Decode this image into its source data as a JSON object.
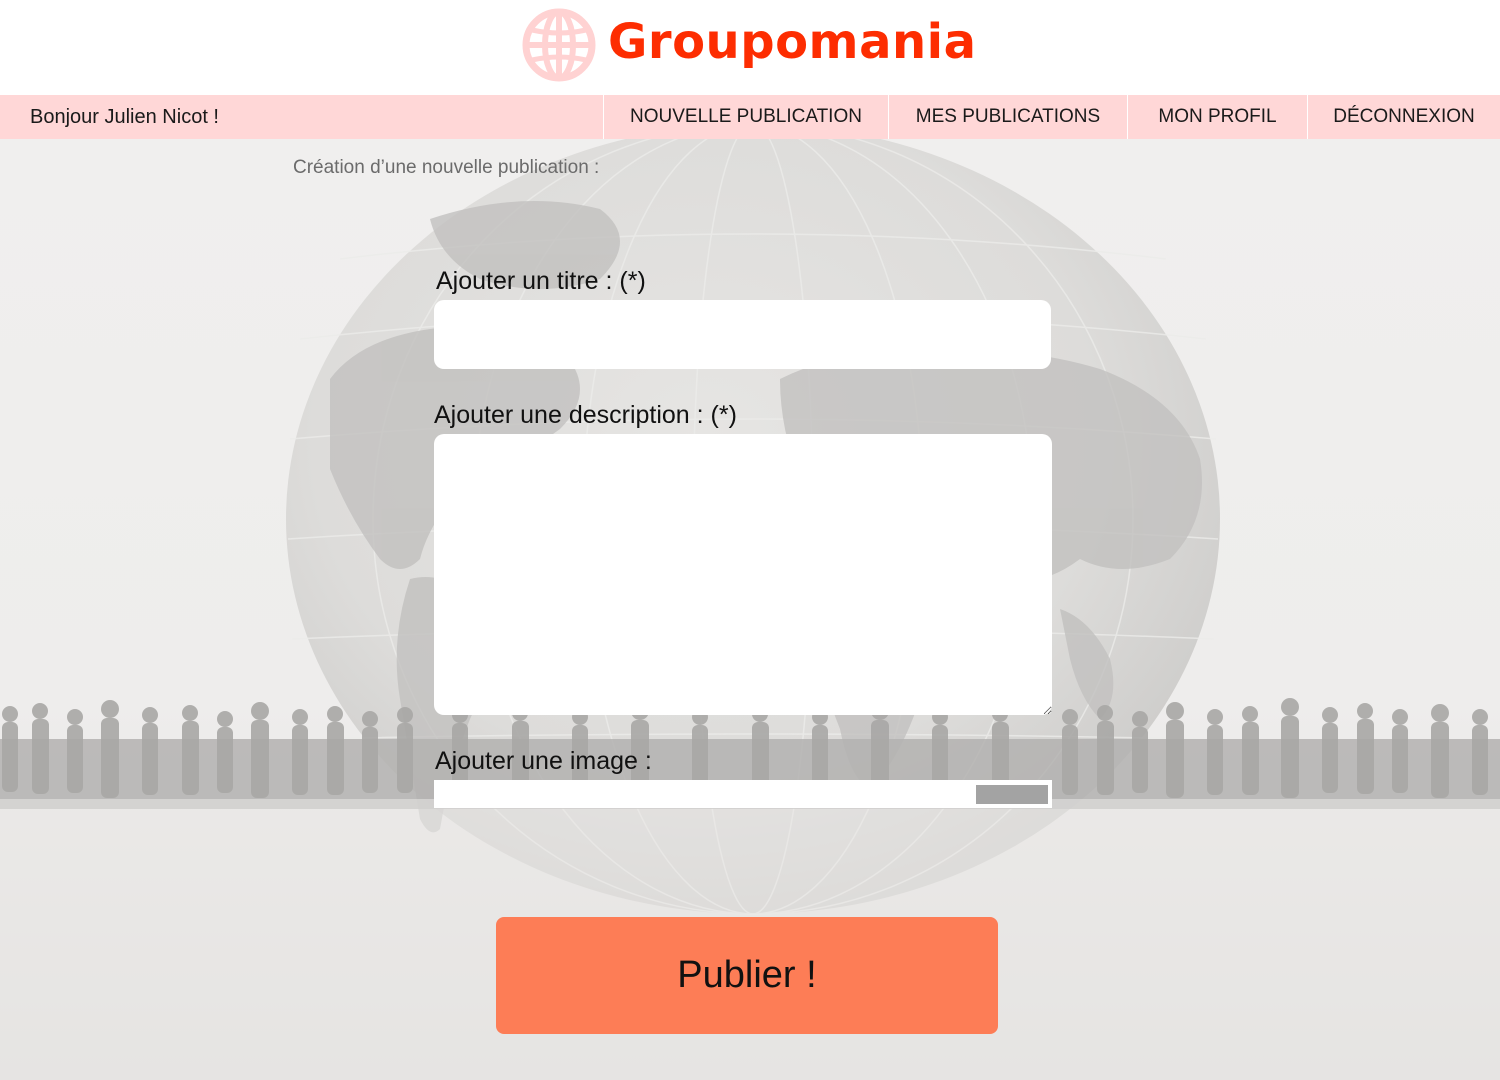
{
  "app": {
    "brand_name": "Groupomania",
    "brand_color": "#fd2d01",
    "logo_icon": "globe-icon"
  },
  "navbar": {
    "greeting": "Bonjour Julien Nicot !",
    "background": "#ffd7d7",
    "items": [
      {
        "label": "NOUVELLE PUBLICATION"
      },
      {
        "label": "MES PUBLICATIONS"
      },
      {
        "label": "MON PROFIL"
      },
      {
        "label": "DÉCONNEXION"
      }
    ]
  },
  "form": {
    "section_title": "Création d’une nouvelle publication :",
    "title_label": "Ajouter un titre : (*)",
    "title_value": "",
    "description_label": "Ajouter une description : (*)",
    "description_value": "",
    "image_label": "Ajouter une image :",
    "submit_label": "Publier !",
    "submit_color": "#fd7d56"
  }
}
